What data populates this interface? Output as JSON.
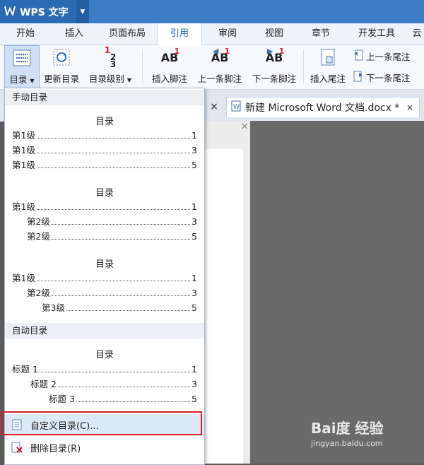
{
  "app": {
    "title": "WPS 文字"
  },
  "tabs": [
    "开始",
    "插入",
    "页面布局",
    "引用",
    "审阅",
    "视图",
    "章节",
    "开发工具",
    "云"
  ],
  "active_tab": "引用",
  "ribbon": {
    "toc_label": "目录",
    "update_toc": "更新目录",
    "toc_level": "目录级别",
    "insert_footnote": "插入脚注",
    "prev_footnote": "上一条脚注",
    "next_footnote": "下一条脚注",
    "insert_endnote": "插入尾注",
    "prev_endnote": "上一条尾注",
    "next_endnote": "下一条尾注",
    "footnote_glyph": "AB",
    "footnote_num": "1",
    "level_nums": [
      "1",
      "2",
      "3"
    ]
  },
  "doc_tabs": [
    {
      "label": "新建 Microsoft Word 文档.docx *",
      "close": "×"
    }
  ],
  "close_glyph": "×",
  "menu": {
    "manual_header": "手动目录",
    "auto_header": "自动目录",
    "toc_heading": "目录",
    "manual_1": [
      {
        "text": "第1级",
        "page": "1",
        "indent": 0
      },
      {
        "text": "第1级",
        "page": "3",
        "indent": 0
      },
      {
        "text": "第1级",
        "page": "5",
        "indent": 0
      }
    ],
    "manual_2": [
      {
        "text": "第1级",
        "page": "1",
        "indent": 0
      },
      {
        "text": "第2级",
        "page": "3",
        "indent": 1
      },
      {
        "text": "第2级",
        "page": "5",
        "indent": 1
      }
    ],
    "manual_3": [
      {
        "text": "第1级",
        "page": "1",
        "indent": 0
      },
      {
        "text": "第2级",
        "page": "3",
        "indent": 1
      },
      {
        "text": "第3级",
        "page": "5",
        "indent": 2
      }
    ],
    "auto_1": [
      {
        "text": "标题 1",
        "page": "1",
        "indent": 0
      },
      {
        "text": "标题 2",
        "page": "3",
        "indent": 1
      },
      {
        "text": "标题 3",
        "page": "5",
        "indent": 2
      }
    ],
    "custom_toc": "自定义目录(C)...",
    "delete_toc": "删除目录(R)"
  },
  "watermark": {
    "brand": "Bai度 经验",
    "url": "jingyan.baidu.com"
  }
}
